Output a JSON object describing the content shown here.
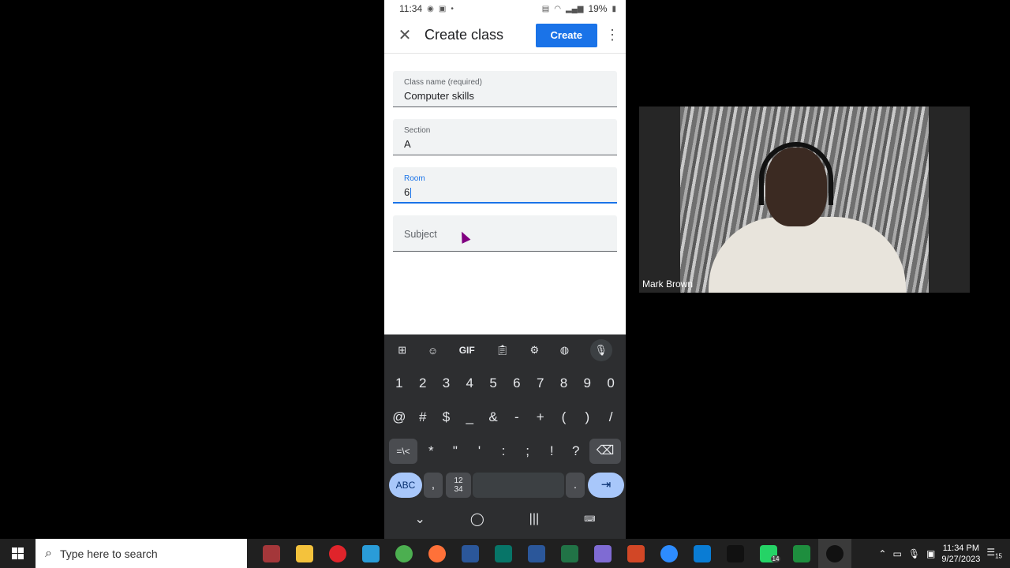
{
  "phone": {
    "status": {
      "time": "11:34",
      "battery": "19%"
    },
    "appbar": {
      "title": "Create class",
      "create_label": "Create"
    },
    "fields": [
      {
        "label": "Class name (required)",
        "value": "Computer skills"
      },
      {
        "label": "Section",
        "value": "A"
      },
      {
        "label": "Room",
        "value": "6"
      },
      {
        "label": "Subject",
        "value": ""
      }
    ],
    "keyboard": {
      "toolbar": [
        "grid-icon",
        "sticker-icon",
        "GIF",
        "clipboard-icon",
        "gear-icon",
        "palette-icon",
        "mic-icon"
      ],
      "gif_label": "GIF",
      "row1": [
        "1",
        "2",
        "3",
        "4",
        "5",
        "6",
        "7",
        "8",
        "9",
        "0"
      ],
      "row2": [
        "@",
        "#",
        "$",
        "_",
        "&",
        "-",
        "+",
        "(",
        ")",
        "/"
      ],
      "row3": [
        "=\\<",
        "*",
        "\"",
        "'",
        ":",
        ";",
        "!",
        "?"
      ],
      "row4": {
        "abc": "ABC",
        "comma": ",",
        "numpad_top": "12",
        "numpad_bottom": "34",
        "period": "."
      }
    }
  },
  "webcam": {
    "name": "Mark Brown"
  },
  "taskbar": {
    "search_placeholder": "Type here to search",
    "apps": [
      {
        "name": "access-icon",
        "color": "#a4373a"
      },
      {
        "name": "file-explorer-icon",
        "color": "#f4c23c"
      },
      {
        "name": "opera-icon",
        "color": "#e0242b"
      },
      {
        "name": "edge-icon",
        "color": "#2a9cd8"
      },
      {
        "name": "chrome-icon",
        "color": "#4caf50"
      },
      {
        "name": "firefox-icon",
        "color": "#ff7139"
      },
      {
        "name": "calculator-icon",
        "color": "#2b579a"
      },
      {
        "name": "publisher-icon",
        "color": "#077568"
      },
      {
        "name": "word-icon",
        "color": "#2b579a"
      },
      {
        "name": "excel-icon",
        "color": "#217346"
      },
      {
        "name": "copilot-icon",
        "color": "#7f6bd3"
      },
      {
        "name": "powerpoint-icon",
        "color": "#d24726"
      },
      {
        "name": "zoom-icon",
        "color": "#2d8cff"
      },
      {
        "name": "mail-icon",
        "color": "#0a7cd4"
      },
      {
        "name": "tiktok-icon",
        "color": "#111111"
      },
      {
        "name": "whatsapp-icon",
        "color": "#25d366"
      },
      {
        "name": "classroom-icon",
        "color": "#1e8e3e"
      },
      {
        "name": "obs-icon",
        "color": "#111111"
      }
    ],
    "whatsapp_badge": "14",
    "clock_time": "11:34 PM",
    "clock_date": "9/27/2023",
    "notification_count": "15"
  }
}
